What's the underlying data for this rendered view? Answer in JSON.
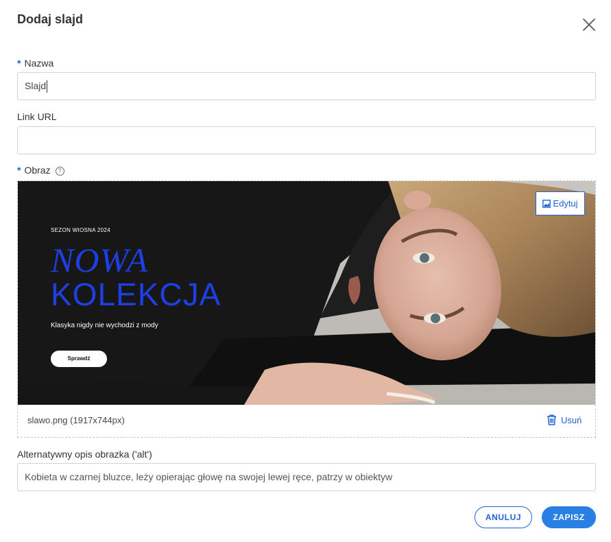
{
  "dialog": {
    "title": "Dodaj slajd",
    "close_icon": "close-icon"
  },
  "fields": {
    "name": {
      "required_mark": "*",
      "label": "Nazwa",
      "value": "Slajd"
    },
    "link": {
      "label": "Link URL",
      "value": ""
    },
    "image": {
      "required_mark": "*",
      "label": "Obraz",
      "help_icon": "?",
      "edit_label": "Edytuj",
      "file_info": "slawo.png (1917x744px)",
      "delete_label": "Usuń",
      "banner": {
        "season": "SEZON WIOSNA 2024",
        "headline_1": "NOWA",
        "headline_2": "KOLEKCJA",
        "tagline": "Klasyka nigdy nie wychodzi z mody",
        "cta": "Sprawdź"
      }
    },
    "alt": {
      "label": "Alternatywny opis obrazka ('alt')",
      "value": "Kobieta w czarnej bluzce, leży opierając głowę na swojej lewej ręce, patrzy w obiektyw"
    }
  },
  "actions": {
    "cancel": "ANULUJ",
    "save": "ZAPISZ"
  },
  "colors": {
    "accent": "#1f63d8",
    "save_bg": "#2a7fe4",
    "banner_headline": "#1f3fe6"
  }
}
